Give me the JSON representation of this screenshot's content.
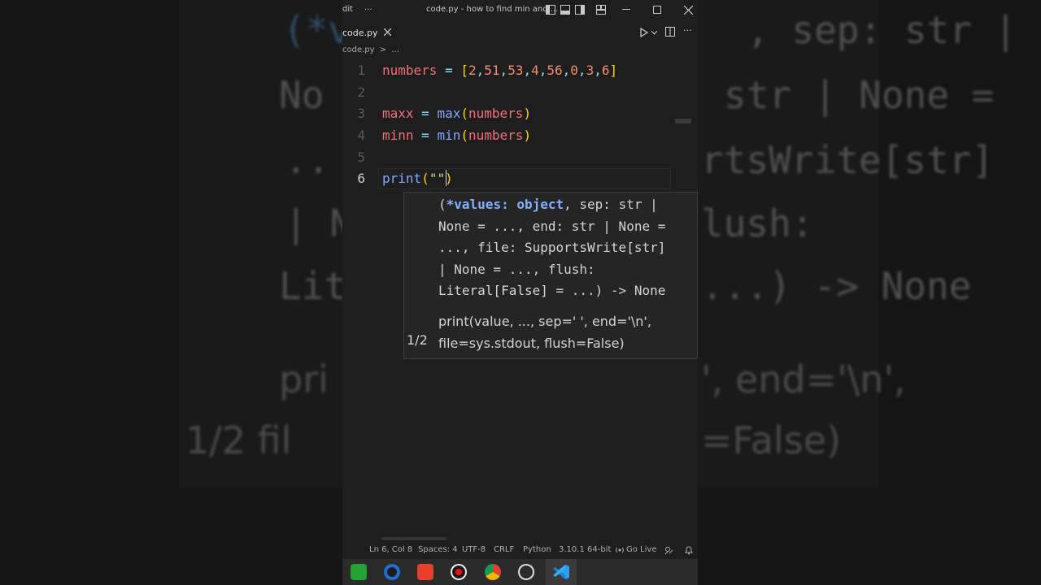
{
  "window": {
    "title": "code.py - how to find min and ...",
    "menu_fragment": "dit",
    "menu_ellipsis": "..."
  },
  "tab": {
    "label": "code.py"
  },
  "breadcrumb": {
    "file": "code.py",
    "sep": ">",
    "rest": "..."
  },
  "editor": {
    "line_numbers": [
      "1",
      "2",
      "3",
      "4",
      "5",
      "6"
    ]
  },
  "signature_popup": {
    "line1a": "(",
    "line1_param": "*values: object",
    "line1b": ", sep: str |",
    "line2": "None = ..., end: str | None =",
    "line3": "..., file: SupportsWrite[str]",
    "line4": "| None = ..., flush:",
    "line5": "Literal[False] = ...) -> None",
    "doc1": "print(value, ..., sep=' ', end='\\n',",
    "doc2": "file=sys.stdout, flush=False)",
    "pager": "1/2"
  },
  "statusbar": {
    "position": "Ln 6, Col 8",
    "spaces": "Spaces: 4",
    "encoding": "UTF-8",
    "eol": "CRLF",
    "language": "Python",
    "interpreter": "3.10.1 64-bit",
    "golive": "Go Live"
  },
  "colors": {
    "editor_bg": "#1e1e1e",
    "variable": "#f07178",
    "function": "#82aaff",
    "bracket": "#ffd700"
  }
}
